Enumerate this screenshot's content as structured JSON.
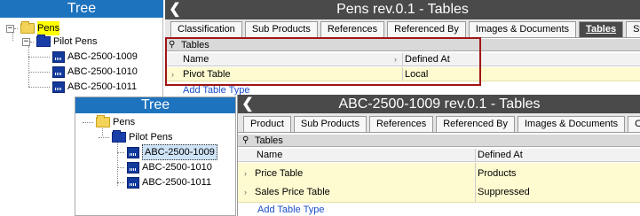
{
  "tree_back": {
    "title": "Tree",
    "pens": "Pens",
    "pilot_pens": "Pilot Pens",
    "items": [
      "ABC-2500-1009",
      "ABC-2500-1010",
      "ABC-2500-1011"
    ]
  },
  "back_panel": {
    "title": "Pens rev.0.1 - Tables",
    "tabs": [
      "Classification",
      "Sub Products",
      "References",
      "Referenced By",
      "Images & Documents",
      "Tables",
      "Sta"
    ],
    "active_tab": "Tables",
    "grid_title": "Tables",
    "columns": [
      "Name",
      "Defined At"
    ],
    "rows": [
      {
        "name": "Pivot Table",
        "defined_at": "Local"
      }
    ],
    "add_link": "Add Table Type"
  },
  "tree_front": {
    "title": "Tree",
    "pens": "Pens",
    "pilot_pens": "Pilot Pens",
    "items": [
      "ABC-2500-1009",
      "ABC-2500-1010",
      "ABC-2500-1011"
    ],
    "selected": "ABC-2500-1009"
  },
  "front_panel": {
    "title": "ABC-2500-1009 rev.0.1 - Tables",
    "tabs": [
      "Product",
      "Sub Products",
      "References",
      "Referenced By",
      "Images & Documents",
      "Com"
    ],
    "grid_title": "Tables",
    "columns": [
      "Name",
      "Defined At"
    ],
    "rows": [
      {
        "name": "Price Table",
        "defined_at": "Products"
      },
      {
        "name": "Sales Price Table",
        "defined_at": "Suppressed"
      }
    ],
    "add_link": "Add Table Type"
  },
  "colors": {
    "tree_header": "#1e73be",
    "title_bar": "#4a4a4a",
    "highlight_row": "#fffbd0",
    "callout": "#a01515"
  }
}
